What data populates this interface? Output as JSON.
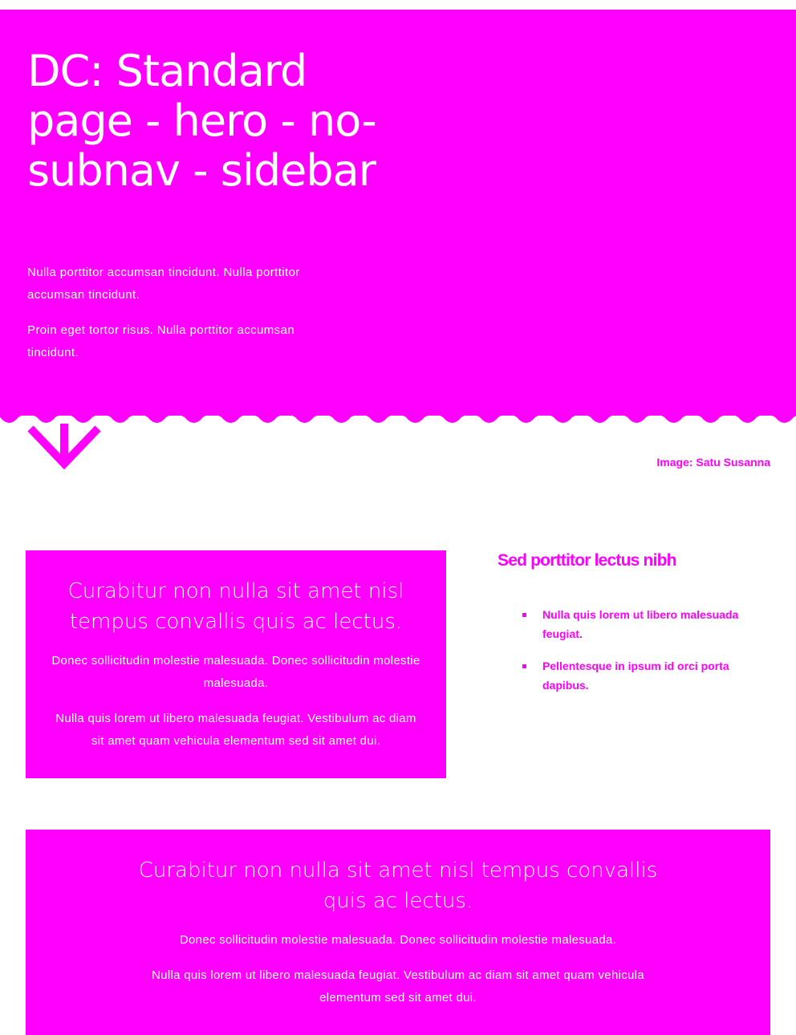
{
  "colors": {
    "accent": "#ff00ff",
    "on_accent": "#ffffff",
    "background": "#ffffff"
  },
  "hero": {
    "title": "DC: Standard page - hero - no-subnav - sidebar",
    "paragraphs": [
      "Nulla porttitor accumsan tincidunt. Nulla porttitor accumsan tincidunt.",
      "Proin eget tortor risus. Nulla porttitor accumsan tincidunt."
    ],
    "arrow_icon": "arrow-down-icon",
    "image_credit": "Image: Satu Susanna"
  },
  "main": {
    "card_1": {
      "heading": "Curabitur non nulla sit amet nisl tempus convallis quis ac lectus.",
      "paragraphs": [
        "Donec sollicitudin molestie malesuada. Donec sollicitudin molestie malesuada.",
        "Nulla quis lorem ut libero malesuada feugiat. Vestibulum ac diam sit amet quam vehicula elementum sed sit amet dui."
      ]
    },
    "card_2": {
      "heading": "Curabitur non nulla sit amet nisl tempus convallis quis ac lectus.",
      "paragraphs": [
        "Donec sollicitudin molestie malesuada. Donec sollicitudin molestie malesuada.",
        "Nulla quis lorem ut libero malesuada feugiat. Vestibulum ac diam sit amet quam vehicula elementum sed sit amet dui."
      ]
    }
  },
  "sidebar": {
    "title": "Sed porttitor lectus nibh",
    "items": [
      "Nulla quis lorem ut libero malesuada feugiat.",
      "Pellentesque in ipsum id orci porta dapibus."
    ]
  }
}
